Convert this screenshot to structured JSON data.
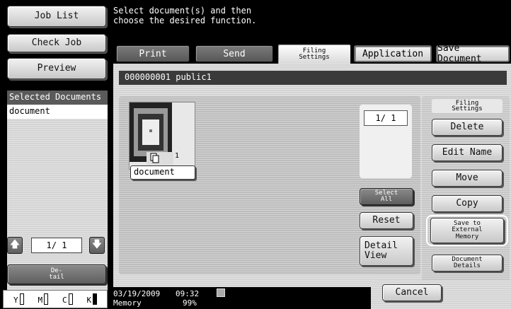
{
  "left_nav": {
    "job_list": "Job List",
    "check_job": "Check Job",
    "preview": "Preview",
    "selected_header": "Selected Documents",
    "selected_items": [
      "document"
    ],
    "page_indicator": "1/ 1",
    "detail": "De-\ntail"
  },
  "toner": [
    {
      "label": "Y",
      "full": false
    },
    {
      "label": "M",
      "full": false
    },
    {
      "label": "C",
      "full": false
    },
    {
      "label": "K",
      "full": true
    }
  ],
  "message": "Select document(s) and then\nchoose the desired function.",
  "tabs": {
    "print": "Print",
    "send": "Send",
    "filing": "Filing\nSettings",
    "application": "Application",
    "save_document": "Save Document"
  },
  "box_bar": "000000001  public1",
  "document": {
    "name": "document",
    "page_count": "1",
    "page_indicator": "1/  1"
  },
  "actions": {
    "select_all": "Select\nAll",
    "reset": "Reset",
    "detail_view": "Detail\nView"
  },
  "filing_panel": {
    "header": "Filing\nSettings",
    "delete": "Delete",
    "edit_name": "Edit Name",
    "move": "Move",
    "copy": "Copy",
    "save_external": "Save to\nExternal\nMemory",
    "document_details": "Document\nDetails"
  },
  "status": {
    "date": "03/19/2009",
    "time": "09:32",
    "memory_label": "Memory",
    "memory_value": "99%"
  },
  "cancel": "Cancel"
}
